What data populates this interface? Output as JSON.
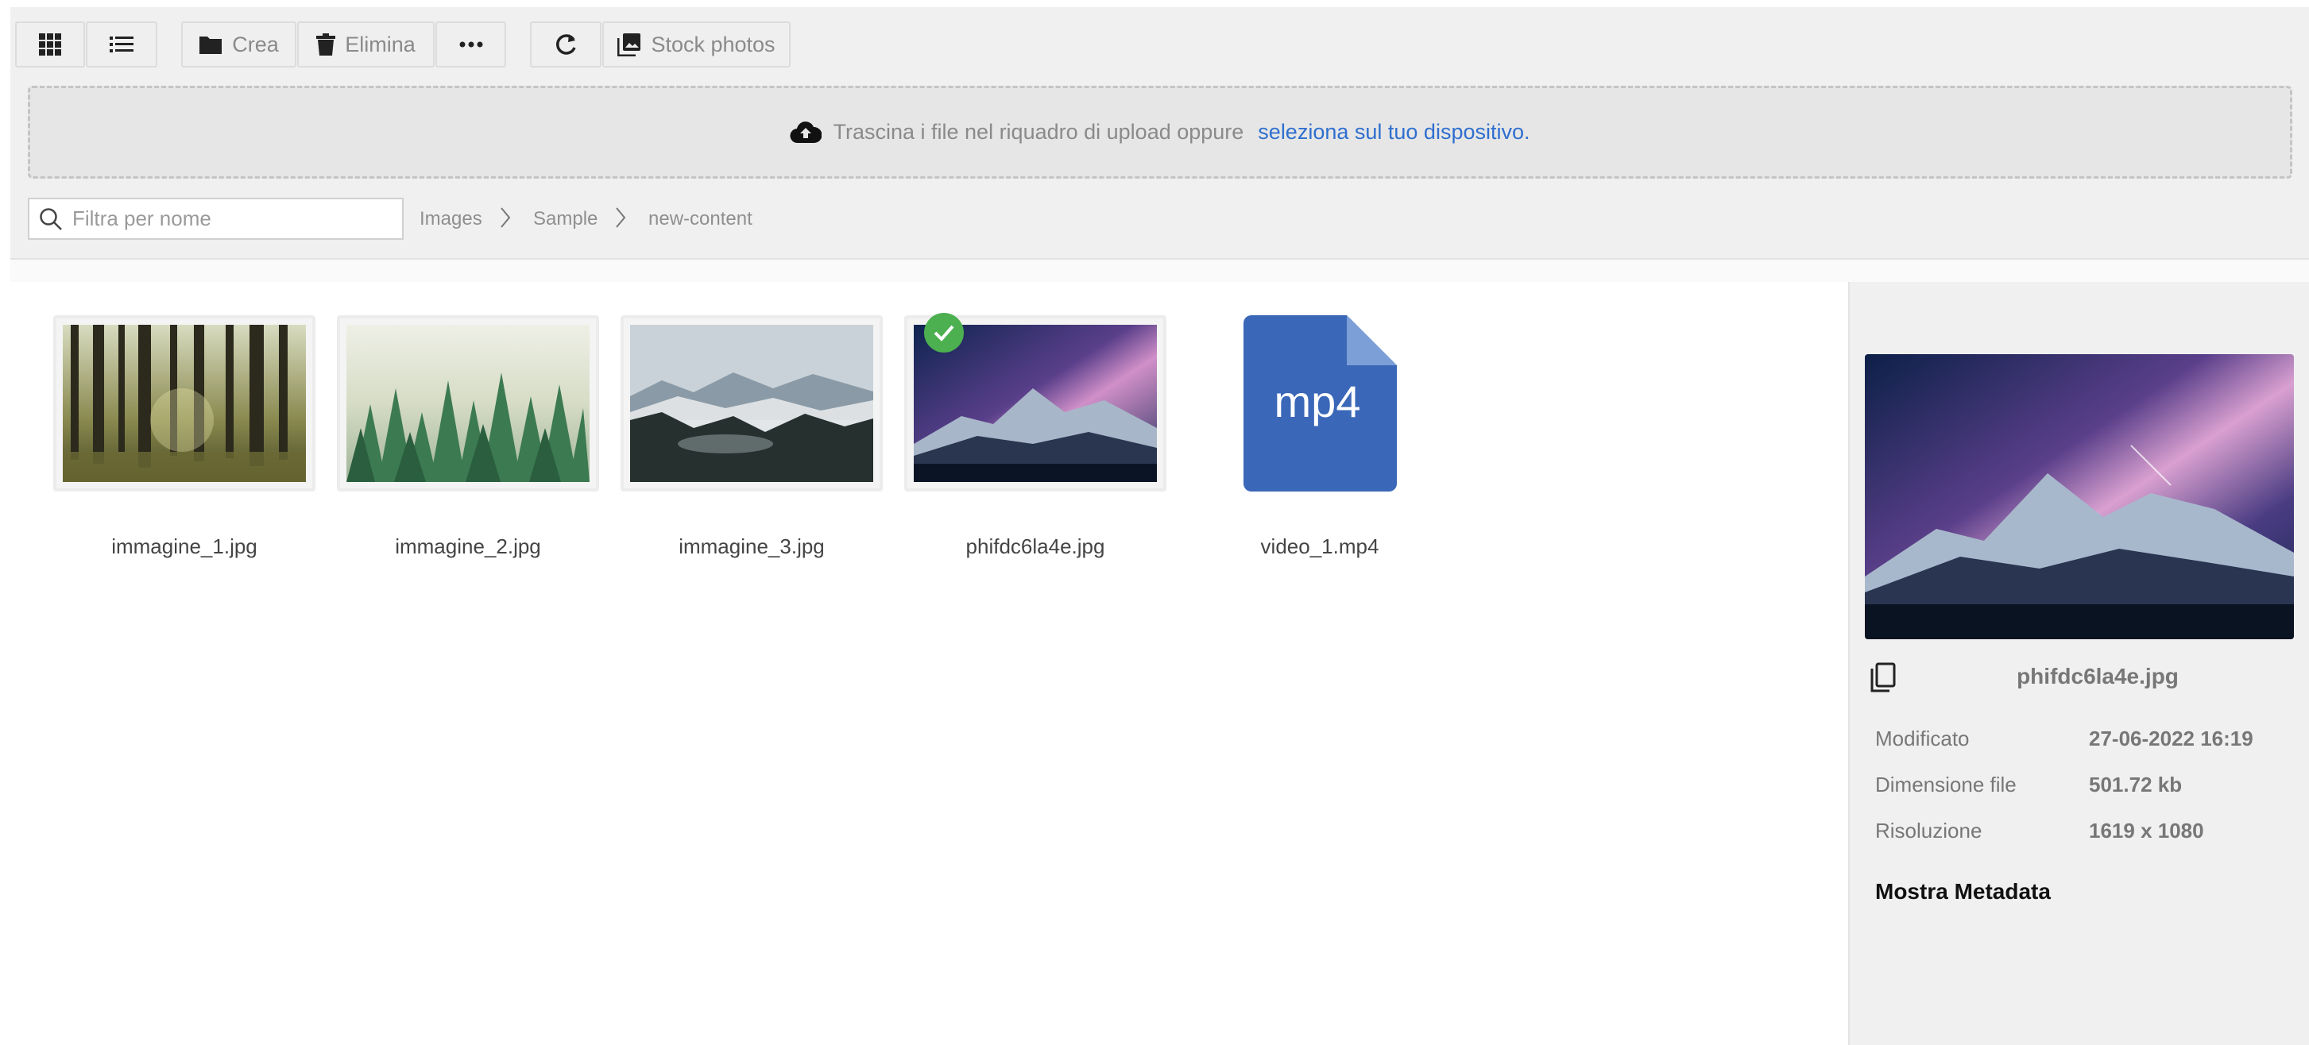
{
  "toolbar": {
    "grid_view_icon": "grid-icon",
    "list_view_icon": "list-icon",
    "create_label": "Crea",
    "delete_label": "Elimina",
    "more_icon": "ellipsis-icon",
    "refresh_icon": "refresh-icon",
    "stock_label": "Stock photos"
  },
  "dropzone": {
    "text": "Trascina i file nel riquadro di upload oppure",
    "link": "seleziona sul tuo dispositivo."
  },
  "filter": {
    "placeholder": "Filtra per nome"
  },
  "breadcrumb": [
    "Images",
    "Sample",
    "new-content"
  ],
  "files": [
    {
      "name": "immagine_1.jpg",
      "kind": "image"
    },
    {
      "name": "immagine_2.jpg",
      "kind": "image"
    },
    {
      "name": "immagine_3.jpg",
      "kind": "image"
    },
    {
      "name": "phifdc6la4e.jpg",
      "kind": "image",
      "selected": true
    },
    {
      "name": "video_1.mp4",
      "kind": "video",
      "badge": "mp4"
    }
  ],
  "details": {
    "filename": "phifdc6la4e.jpg",
    "rows": [
      {
        "label": "Modificato",
        "value": "27-06-2022 16:19"
      },
      {
        "label": "Dimensione file",
        "value": "501.72 kb"
      },
      {
        "label": "Risoluzione",
        "value": "1619 x 1080"
      }
    ],
    "show_metadata": "Mostra Metadata"
  },
  "colors": {
    "accent": "#2f6fcf",
    "selected": "#4caf50",
    "mp4_icon": "#3a67b8"
  }
}
